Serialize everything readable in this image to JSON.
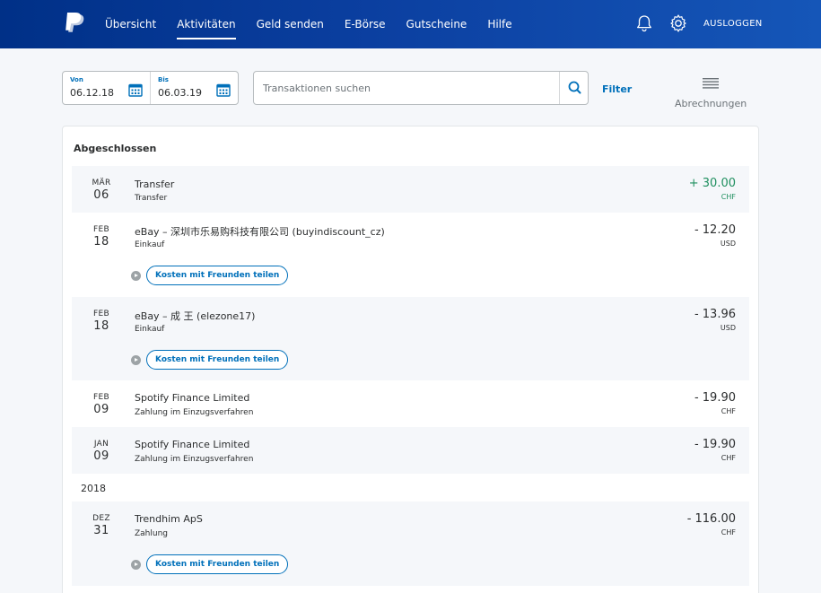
{
  "header": {
    "nav": [
      "Übersicht",
      "Aktivitäten",
      "Geld senden",
      "E-Börse",
      "Gutscheine",
      "Hilfe"
    ],
    "active_nav": "Aktivitäten",
    "logout_label": "AUSLOGGEN",
    "icons": [
      "paypal-logo",
      "bell-icon",
      "gear-icon"
    ]
  },
  "toolbar": {
    "from_label": "Von",
    "from_value": "06.12.18",
    "to_label": "Bis",
    "to_value": "06.03.19",
    "search_placeholder": "Transaktionen suchen",
    "filter_label": "Filter",
    "statements_label": "Abrechnungen"
  },
  "activity": {
    "section_title": "Abgeschlossen",
    "share_label": "Kosten mit Freunden teilen",
    "groups": [
      {
        "year": "",
        "transactions": [
          {
            "month": "MÄR",
            "day": "06",
            "name": "Transfer",
            "type": "Transfer",
            "amount": "+ 30.00",
            "currency": "CHF",
            "positive": true,
            "share": false,
            "shade": true
          },
          {
            "month": "FEB",
            "day": "18",
            "name": "eBay – 深圳市乐易购科技有限公司 (buyindiscount_cz)",
            "type": "Einkauf",
            "amount": "- 12.20",
            "currency": "USD",
            "positive": false,
            "share": true,
            "shade": false
          },
          {
            "month": "FEB",
            "day": "18",
            "name": "eBay – 成 王 (elezone17)",
            "type": "Einkauf",
            "amount": "- 13.96",
            "currency": "USD",
            "positive": false,
            "share": true,
            "shade": true
          },
          {
            "month": "FEB",
            "day": "09",
            "name": "Spotify Finance Limited",
            "type": "Zahlung im Einzugsverfahren",
            "amount": "- 19.90",
            "currency": "CHF",
            "positive": false,
            "share": false,
            "shade": false
          },
          {
            "month": "JAN",
            "day": "09",
            "name": "Spotify Finance Limited",
            "type": "Zahlung im Einzugsverfahren",
            "amount": "- 19.90",
            "currency": "CHF",
            "positive": false,
            "share": false,
            "shade": true
          }
        ]
      },
      {
        "year": "2018",
        "transactions": [
          {
            "month": "DEZ",
            "day": "31",
            "name": "Trendhim ApS",
            "type": "Zahlung",
            "amount": "- 116.00",
            "currency": "CHF",
            "positive": false,
            "share": true,
            "shade": true
          }
        ]
      }
    ]
  },
  "colors": {
    "header_start": "#003087",
    "header_end": "#1556b8",
    "accent": "#0070ba",
    "positive": "#1f8f5f",
    "row_shade": "#f5f7fa"
  }
}
